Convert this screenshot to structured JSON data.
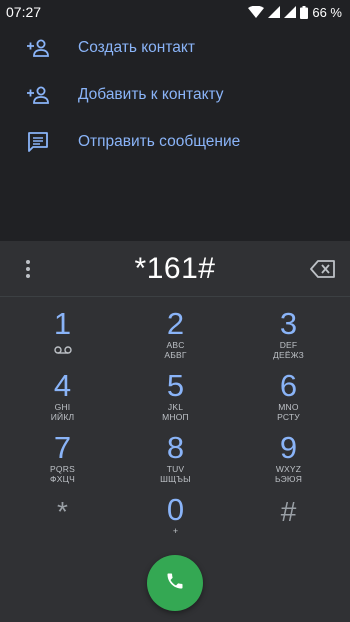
{
  "status_bar": {
    "time": "07:27",
    "battery": "66 %",
    "icons": [
      "wifi-icon",
      "signal-icon",
      "signal-icon",
      "battery-icon"
    ]
  },
  "suggestions": [
    {
      "label": "Создать контакт",
      "icon": "add-person-icon"
    },
    {
      "label": "Добавить к контакту",
      "icon": "add-person-icon"
    },
    {
      "label": "Отправить сообщение",
      "icon": "message-icon"
    }
  ],
  "dialpad": {
    "digits": "*161#",
    "keys": [
      {
        "num": "1",
        "letters": "",
        "letters2": ""
      },
      {
        "num": "2",
        "letters": "ABC",
        "letters2": "АБВГ"
      },
      {
        "num": "3",
        "letters": "DEF",
        "letters2": "ДЕЁЖЗ"
      },
      {
        "num": "4",
        "letters": "GHI",
        "letters2": "ИЙКЛ"
      },
      {
        "num": "5",
        "letters": "JKL",
        "letters2": "МНОП"
      },
      {
        "num": "6",
        "letters": "MNO",
        "letters2": "РСТУ"
      },
      {
        "num": "7",
        "letters": "PQRS",
        "letters2": "ФХЦЧ"
      },
      {
        "num": "8",
        "letters": "TUV",
        "letters2": "ШЩЪЫ"
      },
      {
        "num": "9",
        "letters": "WXYZ",
        "letters2": "ЬЭЮЯ"
      },
      {
        "num": "*",
        "letters": "",
        "letters2": ""
      },
      {
        "num": "0",
        "letters": "+",
        "letters2": ""
      },
      {
        "num": "#",
        "letters": "",
        "letters2": ""
      }
    ]
  },
  "colors": {
    "accent": "#8ab4f8",
    "call": "#34a853",
    "background": "#202124",
    "panel": "#303134"
  }
}
